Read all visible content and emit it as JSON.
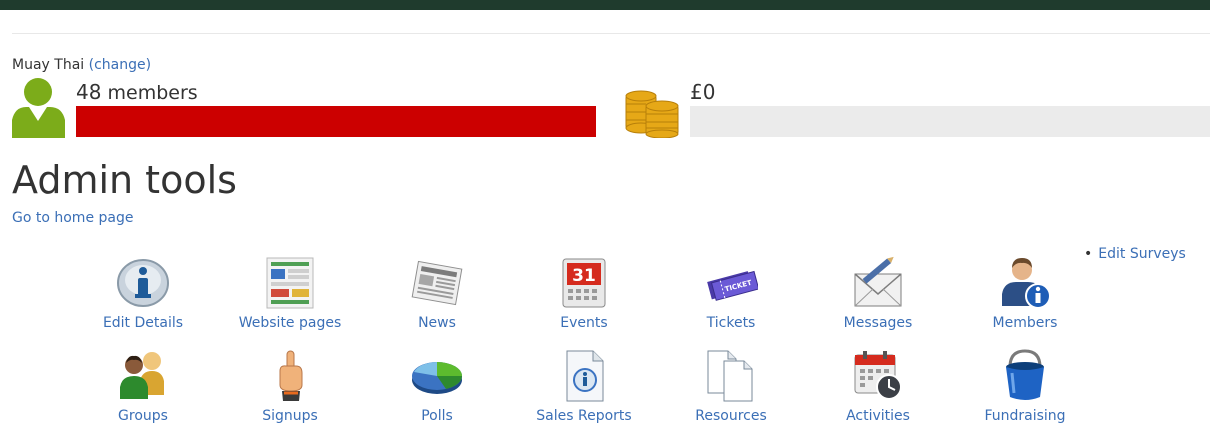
{
  "club": {
    "name": "Muay Thai",
    "change_label": "(change)"
  },
  "stats": {
    "members_count": "48",
    "members_label": "members",
    "money": "£0",
    "members_progress": 1.0,
    "money_progress": 0.0
  },
  "page": {
    "title": "Admin tools",
    "home_link": "Go to home page"
  },
  "tools": [
    {
      "label": "Edit Details",
      "icon": "info-icon"
    },
    {
      "label": "Website pages",
      "icon": "website-pages-icon"
    },
    {
      "label": "News",
      "icon": "newspaper-icon"
    },
    {
      "label": "Events",
      "icon": "calendar-icon"
    },
    {
      "label": "Tickets",
      "icon": "ticket-icon"
    },
    {
      "label": "Messages",
      "icon": "envelope-icon"
    },
    {
      "label": "Members",
      "icon": "member-info-icon"
    },
    {
      "label": "Groups",
      "icon": "group-icon"
    },
    {
      "label": "Signups",
      "icon": "pointing-finger-icon"
    },
    {
      "label": "Polls",
      "icon": "pie-chart-icon"
    },
    {
      "label": "Sales Reports",
      "icon": "report-info-icon"
    },
    {
      "label": "Resources",
      "icon": "documents-icon"
    },
    {
      "label": "Activities",
      "icon": "calendar-clock-icon"
    },
    {
      "label": "Fundraising",
      "icon": "bucket-icon"
    }
  ],
  "sidebar": {
    "surveys_link": "Edit Surveys"
  },
  "colors": {
    "header": "#1f3b2d",
    "link": "#3b6fb6",
    "progress_red": "#cc0000",
    "progress_empty": "#ebebeb"
  }
}
